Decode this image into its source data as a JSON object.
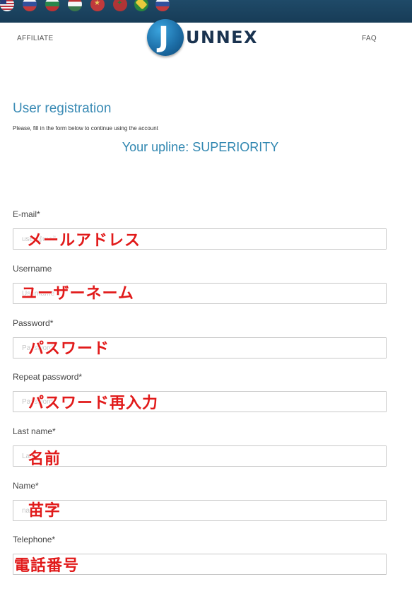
{
  "header": {
    "flags": [
      {
        "name": "us-flag-icon"
      },
      {
        "name": "ru-flag-icon"
      },
      {
        "name": "bg-flag-icon"
      },
      {
        "name": "hu-flag-icon"
      },
      {
        "name": "vn-flag-icon"
      },
      {
        "name": "ma-flag-icon"
      },
      {
        "name": "br-flag-icon"
      },
      {
        "name": "ru-flag-icon"
      }
    ],
    "nav_left": "AFFILIATE",
    "nav_right": "FAQ",
    "logo_letter": "J",
    "logo_text": "UNNEX"
  },
  "page": {
    "title": "User registration",
    "subtitle": "Please, fill in the form below to continue using the account",
    "upline": "Your upline: SUPERIORITY"
  },
  "form": {
    "fields": [
      {
        "label": "E-mail*",
        "placeholder": "user@mail",
        "overlay": "メールアドレス"
      },
      {
        "label": "Username",
        "placeholder": "Username",
        "overlay": "ユーザーネーム"
      },
      {
        "label": "Password*",
        "placeholder": "Password",
        "overlay": "パスワード"
      },
      {
        "label": "Repeat password*",
        "placeholder": "Password",
        "overlay": "パスワード再入力"
      },
      {
        "label": "Last name*",
        "placeholder": "Last",
        "overlay": "名前"
      },
      {
        "label": "Name*",
        "placeholder": "name",
        "overlay": "苗字"
      },
      {
        "label": "Telephone*",
        "placeholder": "",
        "overlay": "電話番号"
      }
    ]
  },
  "colors": {
    "flagbar": "#1f4a68",
    "title": "#3a8bb5",
    "overlay": "#e11a1a"
  }
}
